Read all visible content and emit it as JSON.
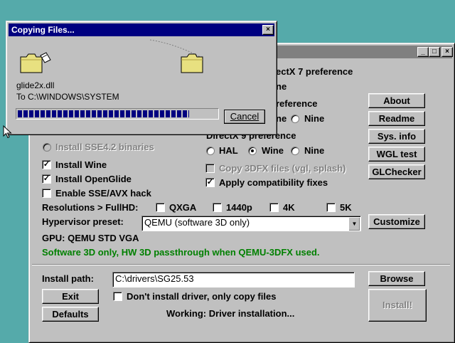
{
  "main_window": {
    "title_buttons": {
      "minimize": "_",
      "maximize": "□",
      "close": "×"
    },
    "directx7_pref_label": "ectX 7 preference",
    "partial_label_ne": "ne",
    "partial_label_reference": "reference",
    "dx7_radio_wine_partial": "ne",
    "dx7_radio_nine": "Nine",
    "directx9_pref_label": "DirectX 9 preference",
    "dx9_options": {
      "hal": "HAL",
      "wine": "Wine",
      "nine": "Nine"
    },
    "install_sse42_label": "Install SSE4.2 binaries",
    "install_wine_label": "Install Wine",
    "install_openglide_label": "Install OpenGlide",
    "enable_sse_avx_label": "Enable SSE/AVX hack",
    "copy_3dfx_label": "Copy 3DFX files (vgl, splash)",
    "apply_compat_label": "Apply compatibility fixes",
    "resolutions_label": "Resolutions > FullHD:",
    "res_options": {
      "qxga": "QXGA",
      "r1440p": "1440p",
      "r4k": "4K",
      "r5k": "5K"
    },
    "hypervisor_label": "Hypervisor preset:",
    "hypervisor_value": "QEMU (software 3D only)",
    "gpu_label": "GPU:  QEMU STD VGA",
    "sw3d_note": "Software 3D only, HW 3D passthrough when QEMU-3DFX used.",
    "install_path_label": "Install path:",
    "install_path_value": "C:\\drivers\\SG25.53",
    "dont_install_label": "Don't install driver, only copy files",
    "status_text": "Working: Driver installation...",
    "buttons": {
      "about": "About",
      "readme": "Readme",
      "sysinfo": "Sys. info",
      "wgltest": "WGL test",
      "glchecker": "GLChecker",
      "customize": "Customize",
      "browse": "Browse",
      "exit": "Exit",
      "defaults": "Defaults",
      "install": "Install!"
    }
  },
  "copy_dialog": {
    "title": "Copying Files...",
    "close_button": "×",
    "filename": "glide2x.dll",
    "destination": "To C:\\WINDOWS\\SYSTEM",
    "progress": 0.86,
    "cancel_label": "Cancel"
  },
  "colors": {
    "desktop": "#55aaaa",
    "title_active": "#000080",
    "title_inactive": "#808080",
    "progress_fill": "#000080",
    "green_note": "#008000"
  }
}
